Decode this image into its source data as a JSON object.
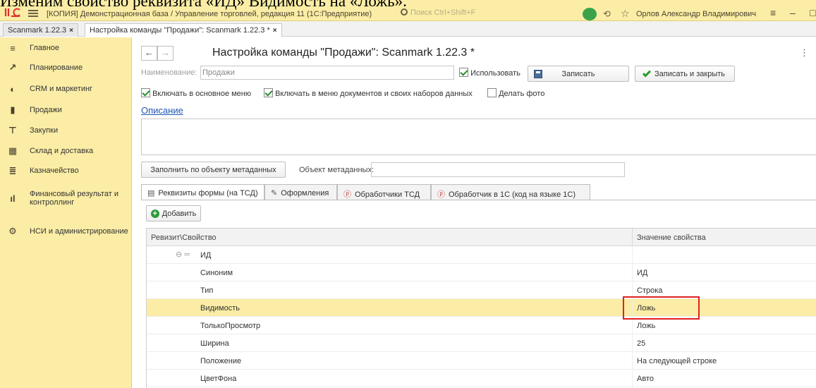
{
  "caption": "Изменим свойство реквизита «ИД» Видимость на «Ложь».",
  "window": {
    "title": "[КОПИЯ] Демонстрационная база / Управление торговлей, редакция 11  (1С:Предприятие)",
    "search_placeholder": "Поиск Ctrl+Shift+F",
    "user": "Орлов Александр Владимирович"
  },
  "tabs": [
    {
      "label": "Scanmark 1.22.3"
    },
    {
      "label": "Настройка команды \"Продажи\": Scanmark 1.22.3 *"
    }
  ],
  "tab_close": "×",
  "sidebar": {
    "items": [
      {
        "label": "Главное",
        "icon": "menu-icon"
      },
      {
        "label": "Планирование",
        "icon": "chart-icon"
      },
      {
        "label": "CRM и маркетинг",
        "icon": "crm-icon"
      },
      {
        "label": "Продажи",
        "icon": "bag-icon"
      },
      {
        "label": "Закупки",
        "icon": "cart-icon"
      },
      {
        "label": "Склад и доставка",
        "icon": "warehouse-icon"
      },
      {
        "label": "Казначейство",
        "icon": "treasury-icon"
      },
      {
        "label": "Финансовый результат и контроллинг",
        "icon": "finance-chart-icon"
      },
      {
        "label": "НСИ и администрирование",
        "icon": "gear-icon"
      }
    ]
  },
  "form": {
    "title": "Настройка команды \"Продажи\": Scanmark 1.22.3 *",
    "more": "⋮",
    "name_label": "Наименование:",
    "name_value": "Продажи",
    "use_label": "Использовать",
    "save_label": "Записать",
    "save_close_label": "Записать и закрыть",
    "include_main_menu": "Включать в основное меню",
    "include_doc_menu": "Включать в меню документов и своих наборов данных",
    "take_photo": "Делать фото",
    "description_link": "Описание",
    "fill_button": "Заполнить по объекту метаданных",
    "metadata_label": "Объект метаданных:",
    "add_button": "Добавить"
  },
  "form_tabs": [
    {
      "label": "Реквизиты формы (на ТСД)"
    },
    {
      "label": "Оформления"
    },
    {
      "label": "Обработчики ТСД"
    },
    {
      "label": "Обработчик в 1С  (код на языке 1С)"
    }
  ],
  "grid": {
    "col1": "Ревизит\\Свойство",
    "col2": "Значение свойства",
    "group": "ИД",
    "rows": [
      {
        "key": "Синоним",
        "value": "ИД"
      },
      {
        "key": "Тип",
        "value": "Строка"
      },
      {
        "key": "Видимость",
        "value": "Ложь"
      },
      {
        "key": "ТолькоПросмотр",
        "value": "Ложь"
      },
      {
        "key": "Ширина",
        "value": "25"
      },
      {
        "key": "Положение",
        "value": "На следующей строке"
      },
      {
        "key": "ЦветФона",
        "value": "Авто"
      }
    ]
  },
  "colors": {
    "chrome_yellow": "#fbeda5",
    "selected_row": "#fbeda5",
    "highlight_box": "#e02020",
    "link": "#1f55b5"
  }
}
